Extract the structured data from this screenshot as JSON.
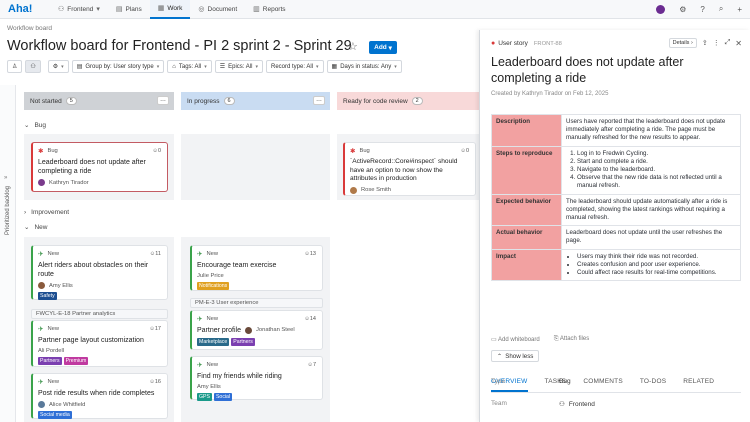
{
  "app": {
    "logo": "Aha!"
  },
  "nav": {
    "product": "Frontend",
    "items": [
      {
        "label": "Plans"
      },
      {
        "label": "Work"
      },
      {
        "label": "Document"
      },
      {
        "label": "Reports"
      }
    ]
  },
  "header": {
    "breadcrumb": "Workflow board",
    "title": "Workflow board for Frontend - PI 2 sprint 2 - Sprint 29",
    "add_label": "Add"
  },
  "toolbar": {
    "group_by": "Group by: User story type",
    "tags": "Tags: All",
    "epics": "Epics: All",
    "record_type": "Record type: All",
    "days_in_status": "Days in status: Any"
  },
  "side": {
    "label": "Prioritized backlog"
  },
  "columns": [
    {
      "name": "Not started",
      "count": "5",
      "color": "#cfd2d6"
    },
    {
      "name": "In progress",
      "count": "6",
      "color": "#c9dcf2"
    },
    {
      "name": "Ready for code review",
      "count": "2",
      "color": "#f8d9d9"
    }
  ],
  "groups": {
    "bug": "Bug",
    "improvement": "Improvement",
    "new": "New"
  },
  "cards": {
    "bug1": {
      "type": "Bug",
      "comments": "0",
      "title": "Leaderboard does not update after completing a ride",
      "owner": "Kathryn Tirador"
    },
    "bug2": {
      "type": "Bug",
      "comments": "0",
      "title": "`ActiveRecord::Core#inspect` should have an option to now show the attributes in production",
      "owner": "Rose Smith"
    },
    "n1": {
      "type": "New",
      "comments": "11",
      "title": "Alert riders about obstacles on their route",
      "owner": "Amy Ellis",
      "tags": [
        "Safety"
      ]
    },
    "n2": {
      "type": "New",
      "comments": "17",
      "title": "Partner page layout customization",
      "owner": "Ali Pordell",
      "tags": [
        "Partners",
        "Premium"
      ]
    },
    "n3": {
      "type": "New",
      "comments": "16",
      "title": "Post ride results when ride completes",
      "owner": "Alice Whitfield",
      "tags": [
        "Social media"
      ]
    },
    "n4": {
      "type": "New",
      "comments": "13",
      "title": "Encourage team exercise",
      "owner": "Julie Price",
      "tags": [
        "Notifications"
      ]
    },
    "n5": {
      "type": "New",
      "comments": "14",
      "title": "Partner profile",
      "owner": "Jonathan Steel",
      "tags": [
        "Marketplace",
        "Partners"
      ]
    },
    "n6": {
      "type": "New",
      "comments": "7",
      "title": "Find my friends while riding",
      "owner": "Amy Ellis",
      "tags": [
        "GPS",
        "Social"
      ]
    }
  },
  "epics": {
    "e1": "FWCYL-E-18 Partner analytics",
    "e2": "PM-E-3 User experience"
  },
  "panel": {
    "record_type": "User story",
    "ref": "FRONT-88",
    "details": "Details",
    "title": "Leaderboard does not update after completing a ride",
    "created": "Created by Kathryn Tirador on Feb 12, 2025",
    "description_label": "Description",
    "description": "Users have reported that the leaderboard does not update immediately after completing a ride. The page must be manually refreshed for the new results to appear.",
    "steps_label": "Steps to reproduce",
    "steps": [
      "Log in to Fredwin Cycling.",
      "Start and complete a ride.",
      "Navigate to the leaderboard.",
      "Observe that the new ride data is not reflected until a manual refresh."
    ],
    "expected_label": "Expected behavior",
    "expected": "The leaderboard should update automatically after a ride is completed, showing the latest rankings without requiring a manual refresh.",
    "actual_label": "Actual behavior",
    "actual": "Leaderboard does not update until the user refreshes the page.",
    "impact_label": "Impact",
    "impact": [
      "Users may think their ride was not recorded.",
      "Creates confusion and poor user experience.",
      "Could affect race results for real-time competitions."
    ],
    "add_whiteboard": "Add whiteboard",
    "attach_files": "Attach files",
    "show_less": "Show less",
    "tabs": [
      "OVERVIEW",
      "TASKS",
      "COMMENTS",
      "TO-DOS",
      "RELATED"
    ],
    "type_label": "Type",
    "type_value": "Bug",
    "team_label": "Team",
    "team_value": "Frontend"
  },
  "colors": {
    "accent": "#0073cf",
    "bug": "#d93a3a",
    "new": "#2a8a3a",
    "desc_key": "#f2a1a1"
  }
}
